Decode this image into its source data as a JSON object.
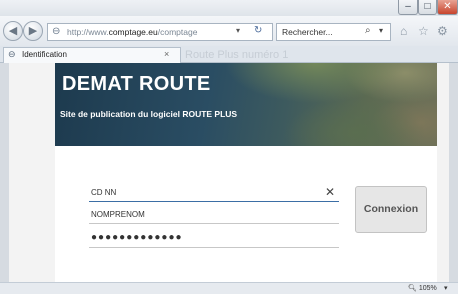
{
  "window": {
    "minimize_glyph": "–",
    "maximize_glyph": "□",
    "close_glyph": "✕"
  },
  "nav": {
    "url_prefix": "http://www.",
    "url_domain": "comptage.eu",
    "url_path": "/comptage",
    "search_placeholder": "Rechercher...",
    "back_glyph": "◀",
    "forward_glyph": "▶"
  },
  "tab": {
    "label": "Identification",
    "ghost_label": "Route Plus numéro 1"
  },
  "banner": {
    "title": "DEMAT ROUTE",
    "subtitle": "Site de publication du logiciel ROUTE PLUS"
  },
  "form": {
    "field1_value": "CD NN",
    "field2_value": "NOMPRENOM",
    "password_value": "●●●●●●●●●●●●●",
    "submit_label": "Connexion"
  },
  "status": {
    "zoom": "105%"
  }
}
